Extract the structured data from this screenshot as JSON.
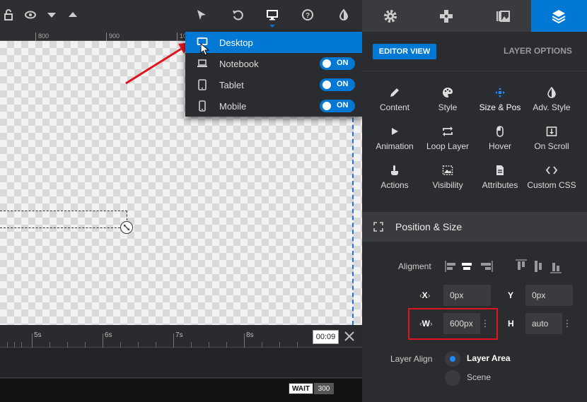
{
  "ruler": {
    "labels": [
      "800",
      "900",
      "10"
    ]
  },
  "device_menu": {
    "items": [
      {
        "label": "Desktop",
        "active": true
      },
      {
        "label": "Notebook",
        "toggle": "ON"
      },
      {
        "label": "Tablet",
        "toggle": "ON"
      },
      {
        "label": "Mobile",
        "toggle": "ON"
      }
    ]
  },
  "timeline": {
    "labels": [
      "5s",
      "6s",
      "7s",
      "8s"
    ],
    "current_time": "00:09",
    "wait_label": "WAIT",
    "wait_value": "300"
  },
  "panel": {
    "editor_view": "EDITOR VIEW",
    "layer_options": "LAYER OPTIONS",
    "options": [
      {
        "label": "Content",
        "icon": "pencil-icon"
      },
      {
        "label": "Style",
        "icon": "palette-icon"
      },
      {
        "label": "Size & Pos",
        "icon": "move-icon",
        "active": true
      },
      {
        "label": "Adv. Style",
        "icon": "contrast-icon"
      },
      {
        "label": "Animation",
        "icon": "play-icon"
      },
      {
        "label": "Loop Layer",
        "icon": "loop-icon"
      },
      {
        "label": "Hover",
        "icon": "mouse-icon"
      },
      {
        "label": "On Scroll",
        "icon": "scroll-icon"
      },
      {
        "label": "Actions",
        "icon": "pointer-icon"
      },
      {
        "label": "Visibility",
        "icon": "visibility-icon"
      },
      {
        "label": "Attributes",
        "icon": "document-icon"
      },
      {
        "label": "Custom CSS",
        "icon": "code-icon"
      }
    ],
    "section_title": "Position & Size",
    "alignment_label": "Aligment",
    "x_axis": "X",
    "x_value": "0px",
    "y_axis": "Y",
    "y_value": "0px",
    "w_axis": "W",
    "w_value": "600px",
    "h_axis": "H",
    "h_value": "auto",
    "layer_align_label": "Layer Align",
    "layer_area": "Layer Area",
    "scene": "Scene"
  },
  "colors": {
    "accent": "#0078d4",
    "highlight": "#e0141e"
  }
}
